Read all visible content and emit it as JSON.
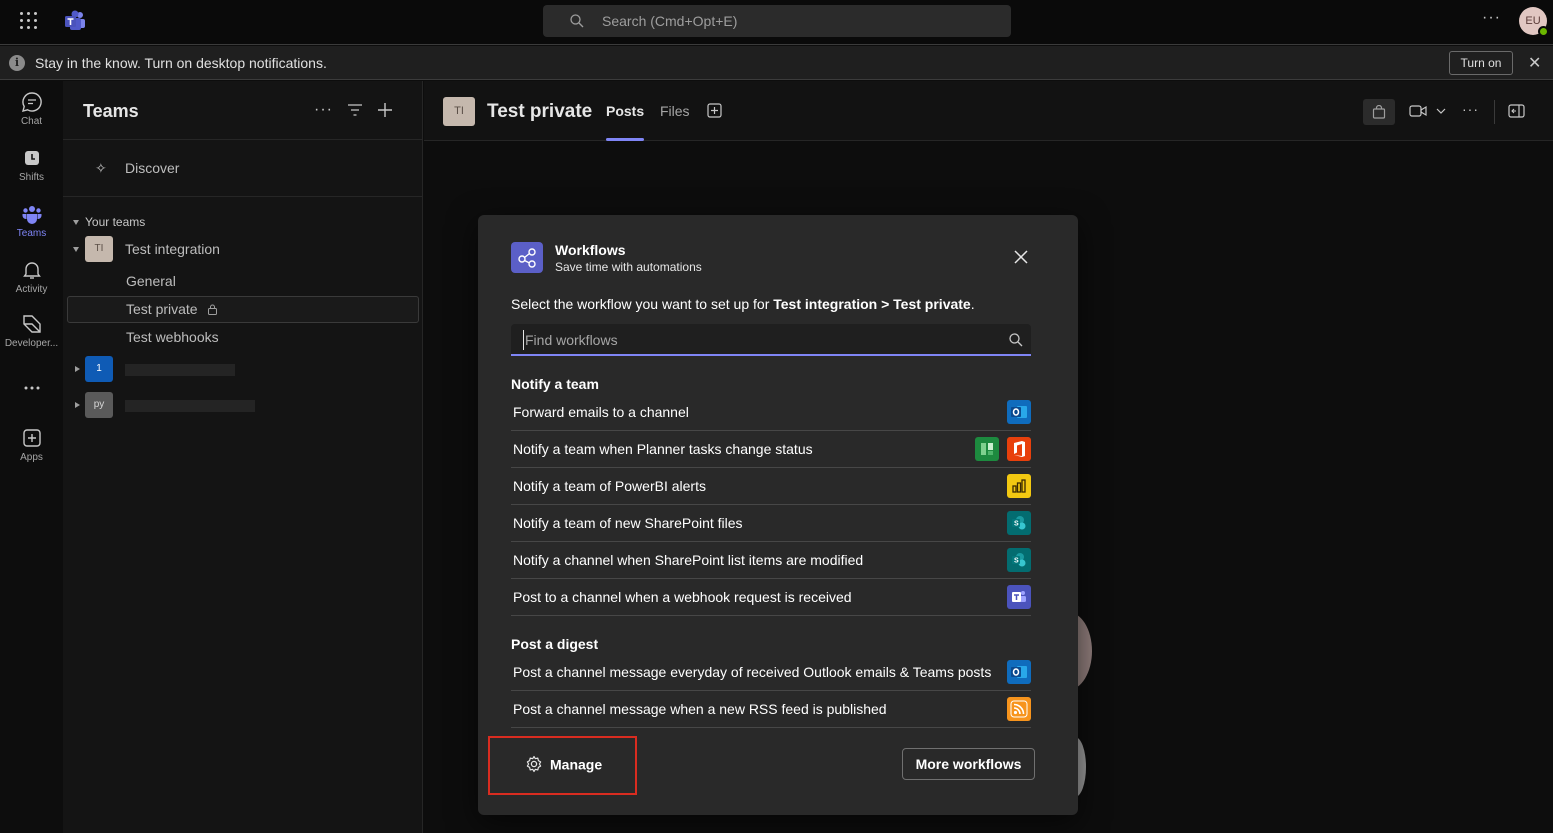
{
  "topbar": {
    "search_placeholder": "Search (Cmd+Opt+E)",
    "more": "···",
    "avatar_initials": "EU"
  },
  "notification": {
    "message": "Stay in the know. Turn on desktop notifications.",
    "button": "Turn on",
    "info": "i"
  },
  "rail": [
    {
      "name": "chat",
      "label": "Chat",
      "icon": "chat-icon"
    },
    {
      "name": "shifts",
      "label": "Shifts",
      "icon": "shifts-icon"
    },
    {
      "name": "teams",
      "label": "Teams",
      "icon": "teams-icon",
      "active": true
    },
    {
      "name": "activity",
      "label": "Activity",
      "icon": "bell-icon"
    },
    {
      "name": "developer",
      "label": "Developer...",
      "icon": "developer-icon"
    },
    {
      "name": "more",
      "label": "",
      "icon": "more-icon"
    },
    {
      "name": "apps",
      "label": "Apps",
      "icon": "apps-icon"
    }
  ],
  "panel": {
    "title": "Teams",
    "discover": "Discover",
    "your_teams": "Your teams",
    "teams": [
      {
        "initials": "TI",
        "name": "Test integration",
        "channels": [
          "General",
          "Test private",
          "Test webhooks"
        ]
      },
      {
        "initials": "1",
        "name": ""
      },
      {
        "initials": "py",
        "name": ""
      }
    ]
  },
  "channel_header": {
    "initials": "TI",
    "title": "Test private",
    "tabs": [
      "Posts",
      "Files"
    ]
  },
  "modal": {
    "title": "Workflows",
    "subtitle": "Save time with automations",
    "desc_prefix": "Select the workflow you want to set up for ",
    "desc_bold": "Test integration > Test private",
    "desc_suffix": ".",
    "search_placeholder": "Find workflows",
    "sections": [
      {
        "title": "Notify a team",
        "items": [
          {
            "label": "Forward emails to a channel",
            "icons": [
              "outlook-icon"
            ]
          },
          {
            "label": "Notify a team when Planner tasks change status",
            "icons": [
              "planner-icon",
              "office-icon"
            ]
          },
          {
            "label": "Notify a team of PowerBI alerts",
            "icons": [
              "powerbi-icon"
            ]
          },
          {
            "label": "Notify a team of new SharePoint files",
            "icons": [
              "sharepoint-icon"
            ]
          },
          {
            "label": "Notify a channel when SharePoint list items are modified",
            "icons": [
              "sharepoint-icon"
            ]
          },
          {
            "label": "Post to a channel when a webhook request is received",
            "icons": [
              "teams-icon"
            ]
          }
        ]
      },
      {
        "title": "Post a digest",
        "items": [
          {
            "label": "Post a channel message everyday of received Outlook emails & Teams posts",
            "icons": [
              "outlook-icon"
            ]
          },
          {
            "label": "Post a channel message when a new RSS feed is published",
            "icons": [
              "rss-icon"
            ]
          }
        ]
      }
    ],
    "manage": "Manage",
    "more_workflows": "More workflows"
  },
  "colors": {
    "accent": "#7f85f5",
    "workflow_icon": "#5b5fc7",
    "highlight": "#d92c20"
  }
}
